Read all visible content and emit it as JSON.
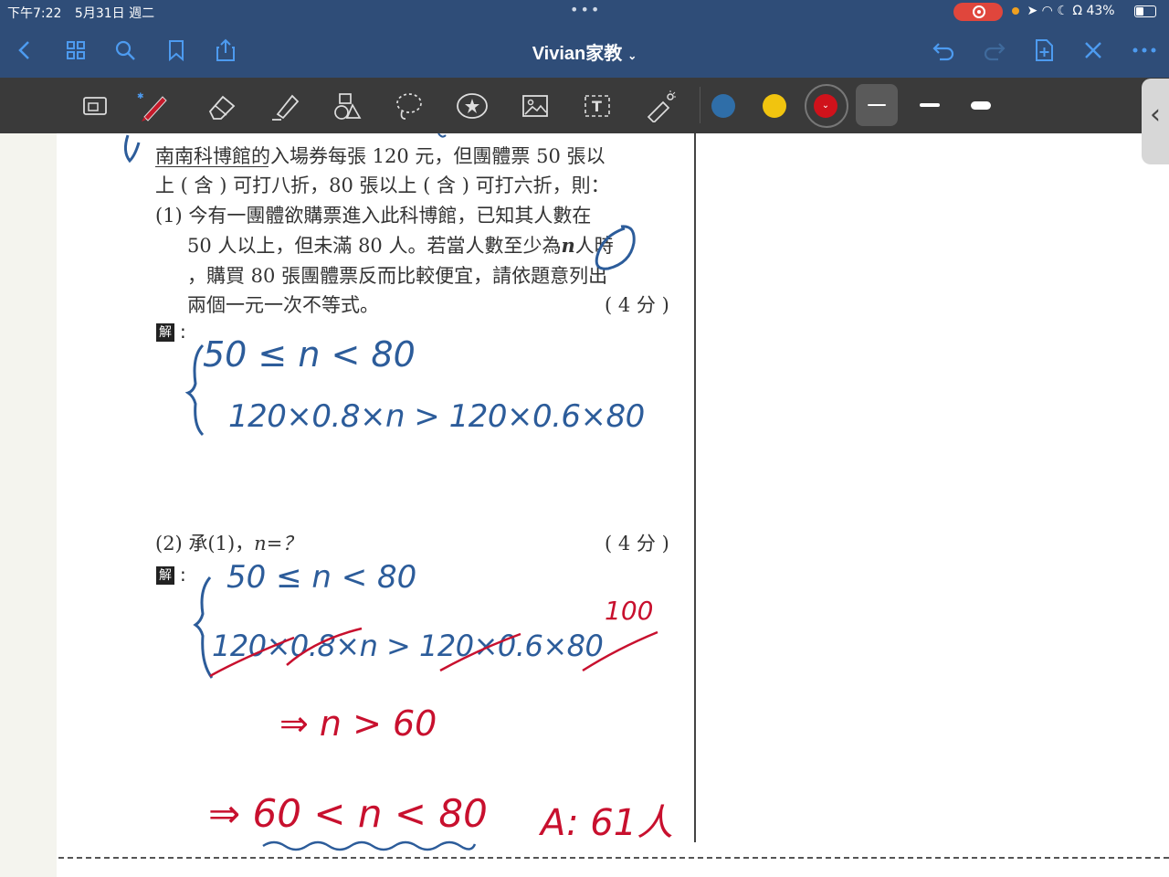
{
  "status": {
    "time": "下午7:22",
    "date": "5月31日 週二",
    "battery": "43%"
  },
  "nav": {
    "title": "Vivian家教"
  },
  "toolbar": {
    "colors": {
      "blue": "#2f6ea8",
      "yellow": "#f1c40f",
      "red": "#d0121b"
    }
  },
  "problem": {
    "intro_1": "南南科博館的入場券每張 120 元，但團體票 50 張以",
    "intro_2": "上 ( 含 ) 可打八折，80 張以上 ( 含 ) 可打六折，則：",
    "p1_1": "(1)  今有一團體欲購票進入此科博館，已知其人數在",
    "p1_2": "50 人以上，但未滿 80 人。若當人數至少為",
    "p1_n": "n",
    "p1_2b": "人時",
    "p1_3": "，購買 80 張團體票反而比較便宜，請依題意列出",
    "p1_4": "兩個一元一次不等式。",
    "p1_score": "( 4 分 )",
    "jie": "解",
    "p2_label": "(2)  承(1)，",
    "p2_n": "n=？",
    "p2_score": "( 4 分 )"
  },
  "handwriting": {
    "a1_line1": "50 ≤ n < 80",
    "a1_line2": "120×0.8×n > 120×0.6×80",
    "a2_line1": "50 ≤ n < 80",
    "a2_line2": "120×0.8×n > 120×0.6×80",
    "a2_over": "100",
    "a2_result": "⇒ n > 60",
    "a2_range": "⇒ 60 < n < 80",
    "answer": "A: 61人"
  }
}
